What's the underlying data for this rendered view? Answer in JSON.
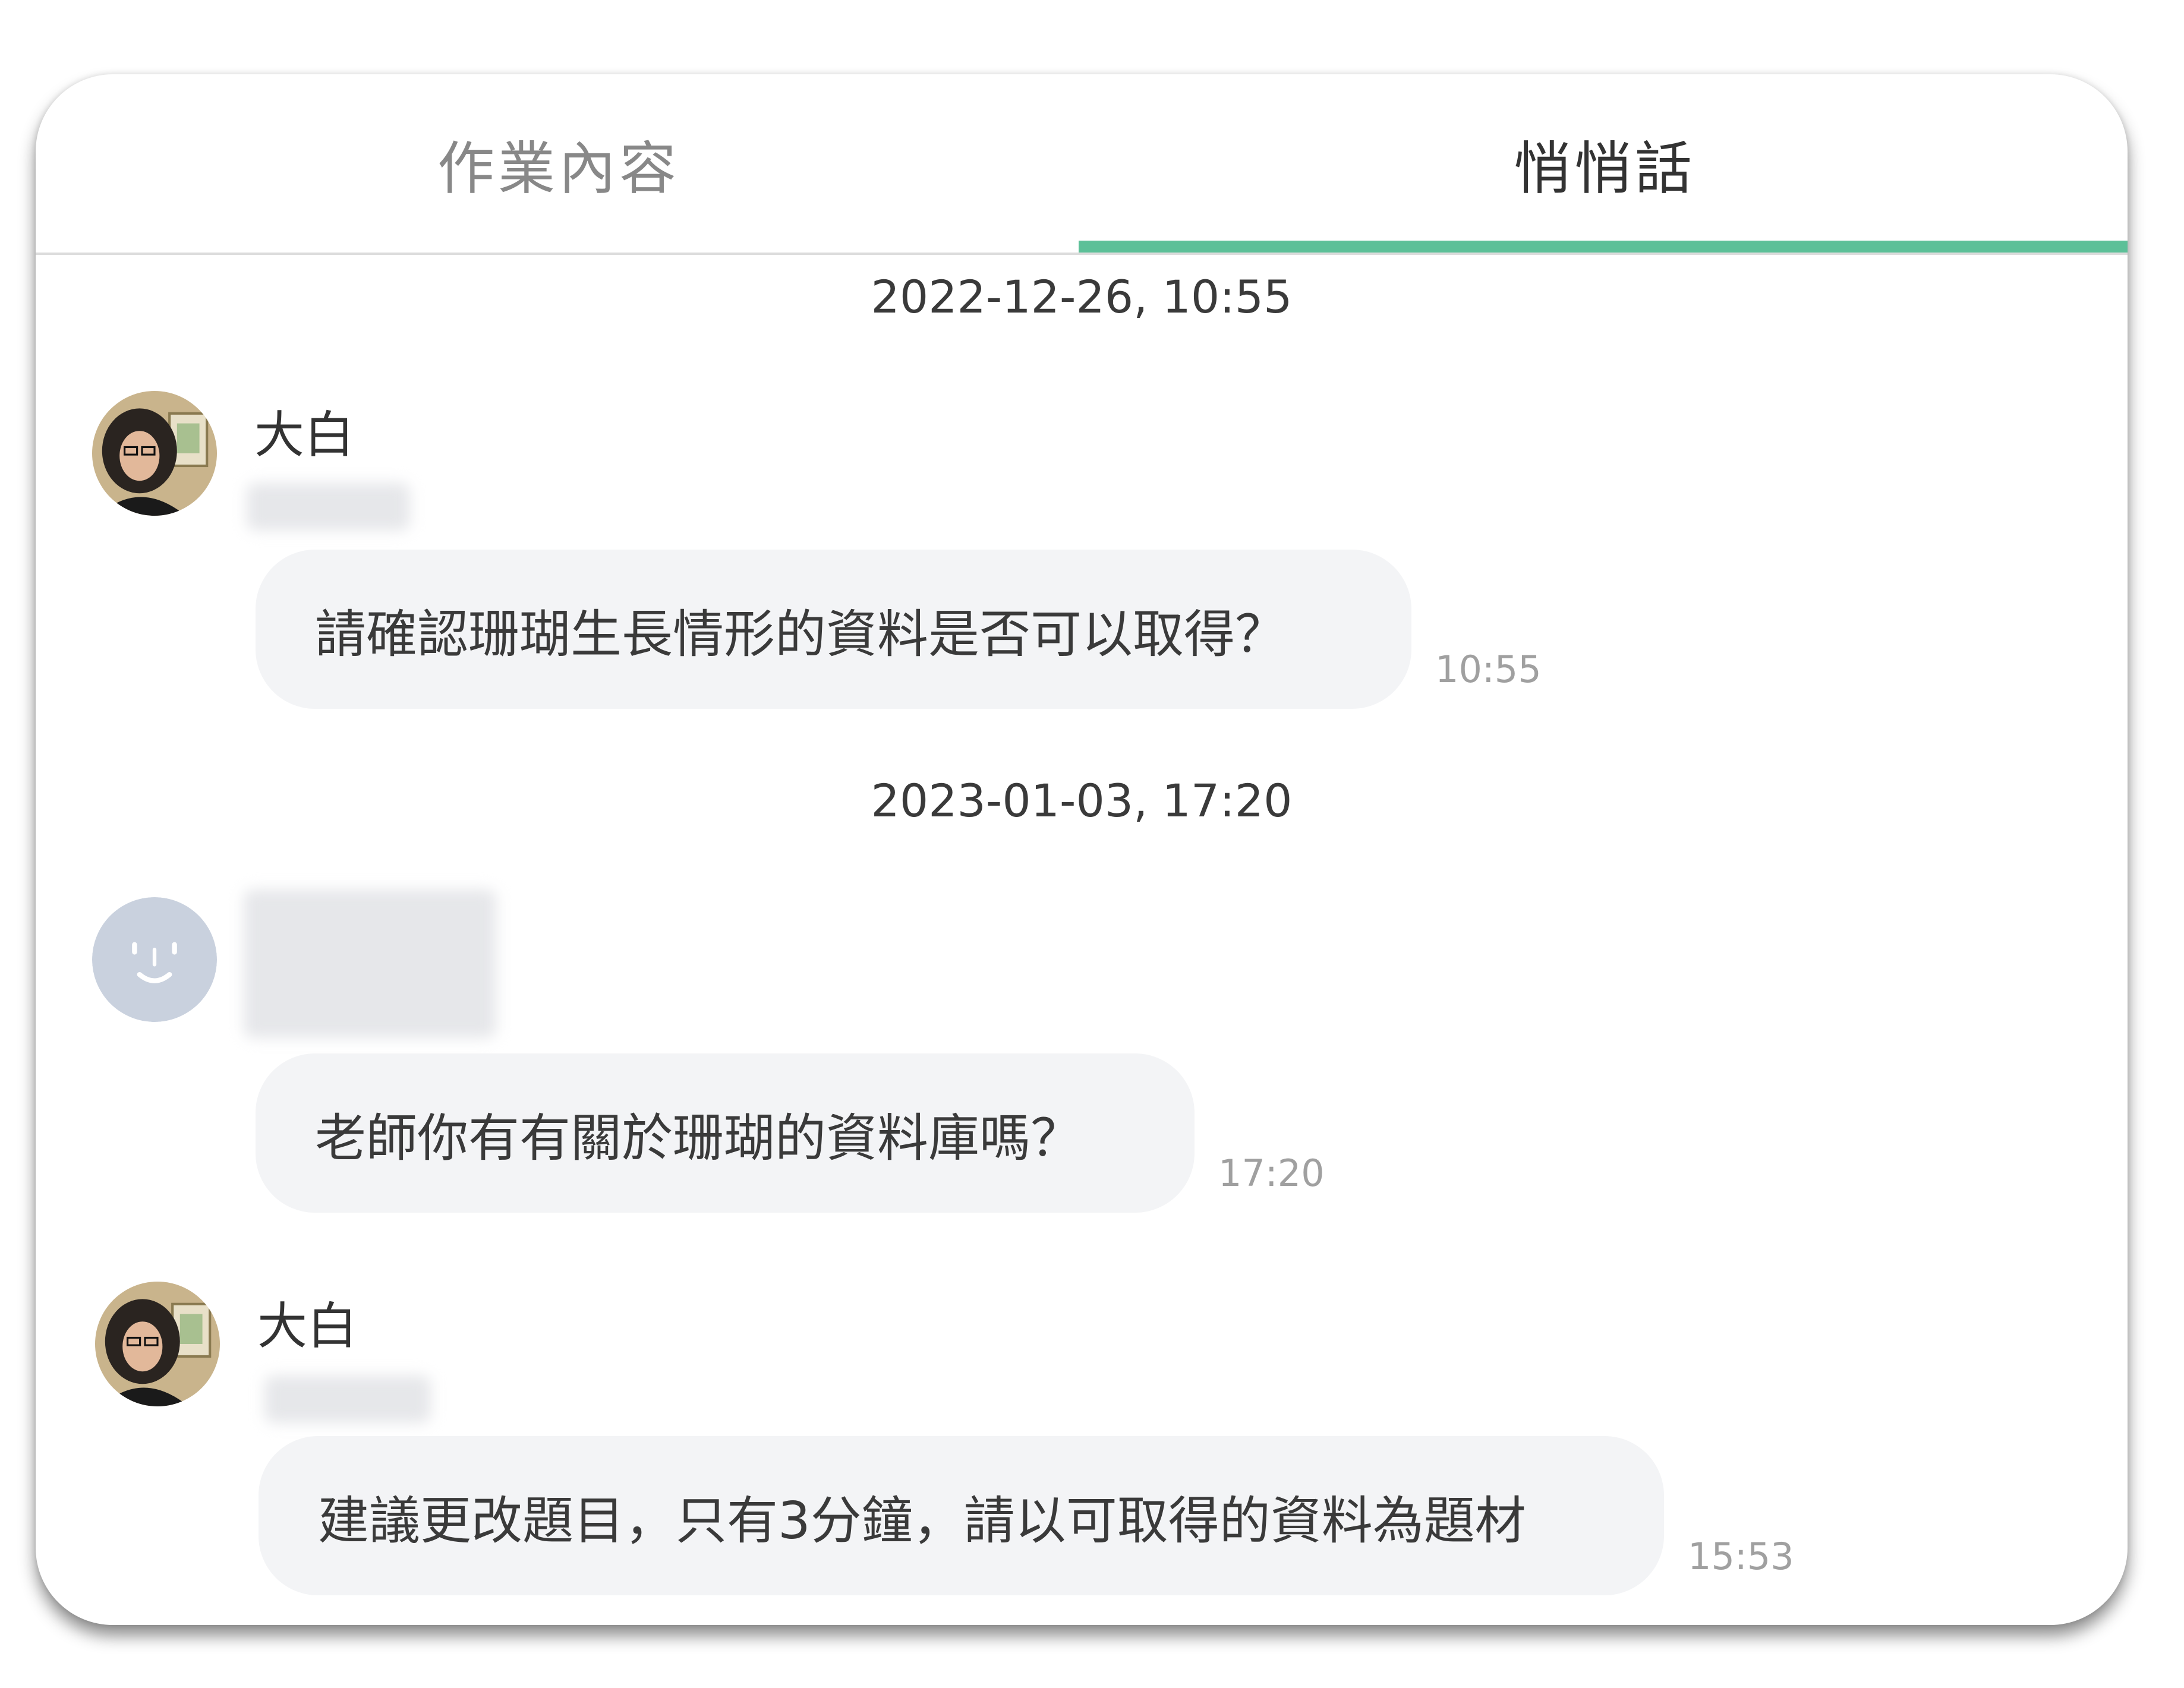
{
  "tabs": [
    {
      "label": "作業內容",
      "active": false
    },
    {
      "label": "悄悄話",
      "active": true
    }
  ],
  "accent_color": "#5cc098",
  "messages_section": {
    "groups": [
      {
        "date": "2022-12-26, 10:55",
        "sender": "大白",
        "avatar": "teacher-photo-icon",
        "text": "請確認珊瑚生長情形的資料是否可以取得？",
        "time": "10:55"
      },
      {
        "date": "2023-01-03, 17:20",
        "sender": "",
        "avatar": "default-face-avatar-icon",
        "text": "老師你有有關於珊瑚的資料庫嗎？",
        "time": "17:20"
      },
      {
        "date": "",
        "sender": "大白",
        "avatar": "teacher-photo-icon",
        "text": "建議更改題目，只有3分鐘，請以可取得的資料為題材",
        "time": "15:53"
      }
    ]
  }
}
